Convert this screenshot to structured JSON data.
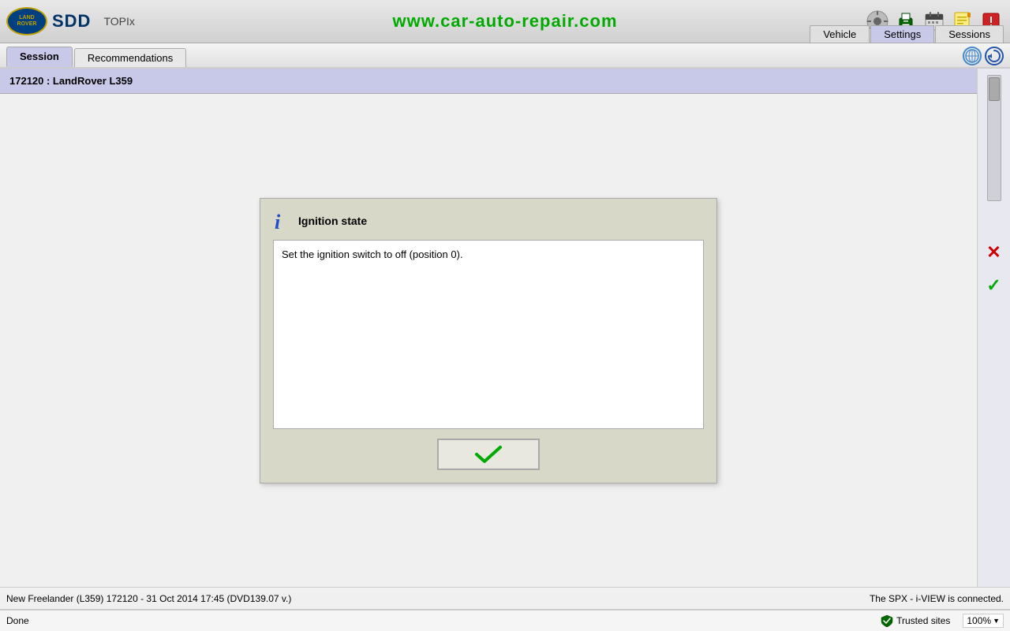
{
  "toolbar": {
    "logo_text": "LAND\nROVER",
    "sdd_label": "SDD",
    "topix_label": "TOPIx",
    "url": "www.car-auto-repair.com",
    "menu_vehicle": "Vehicle",
    "menu_settings": "Settings",
    "menu_sessions": "Sessions"
  },
  "tabs": {
    "session_label": "Session",
    "recommendations_label": "Recommendations"
  },
  "breadcrumb": {
    "text": "172120 : LandRover L359"
  },
  "dialog": {
    "title": "Ignition state",
    "icon": "i",
    "content": "Set the ignition switch to off (position 0).",
    "confirm_check": "✓"
  },
  "status_bar": {
    "left": "New Freelander (L359) 172120 - 31 Oct 2014 17:45 (DVD139.07 v.)",
    "right": "The SPX - i-VIEW is connected."
  },
  "browser_bar": {
    "done": "Done",
    "trusted_sites_icon": "✓",
    "trusted_sites": "Trusted sites",
    "zoom_value": "100%",
    "zoom_arrow": "▼"
  },
  "side_panel": {
    "cancel_icon": "✕",
    "confirm_icon": "✓"
  }
}
